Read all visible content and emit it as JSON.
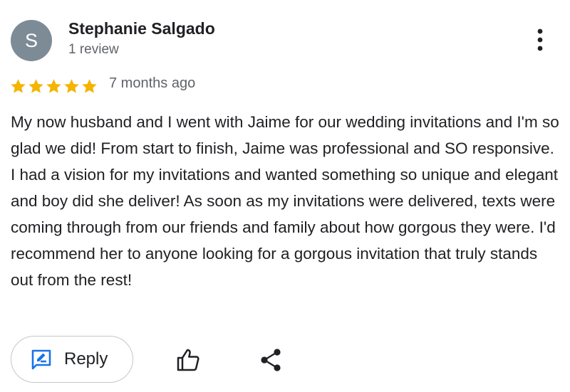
{
  "review": {
    "author": {
      "initial": "S",
      "name": "Stephanie Salgado",
      "review_count": "1 review",
      "avatar_color": "#7d8b96"
    },
    "rating": 5,
    "rating_max": 5,
    "date": "7 months ago",
    "text": "My now husband and I went with Jaime for our wedding invitations and I'm so glad we did! From start to finish, Jaime was professional and SO responsive. I had a vision for my invitations and wanted something so unique and elegant and boy did she deliver! As soon as my invitations were delivered, texts were coming through from our friends and family about how gorgous they were. I'd recommend her to anyone looking for a gorgous invitation that truly stands out from the rest!"
  },
  "actions": {
    "reply_label": "Reply",
    "reply_icon": "rate-review-icon",
    "like_icon": "thumb-up-icon",
    "share_icon": "share-icon",
    "more_icon": "more-vert-icon"
  },
  "colors": {
    "star": "#f4b400",
    "accent": "#1a73e8",
    "secondary_text": "#5f6368",
    "primary_text": "#202124",
    "button_border": "#c4c7c5"
  }
}
